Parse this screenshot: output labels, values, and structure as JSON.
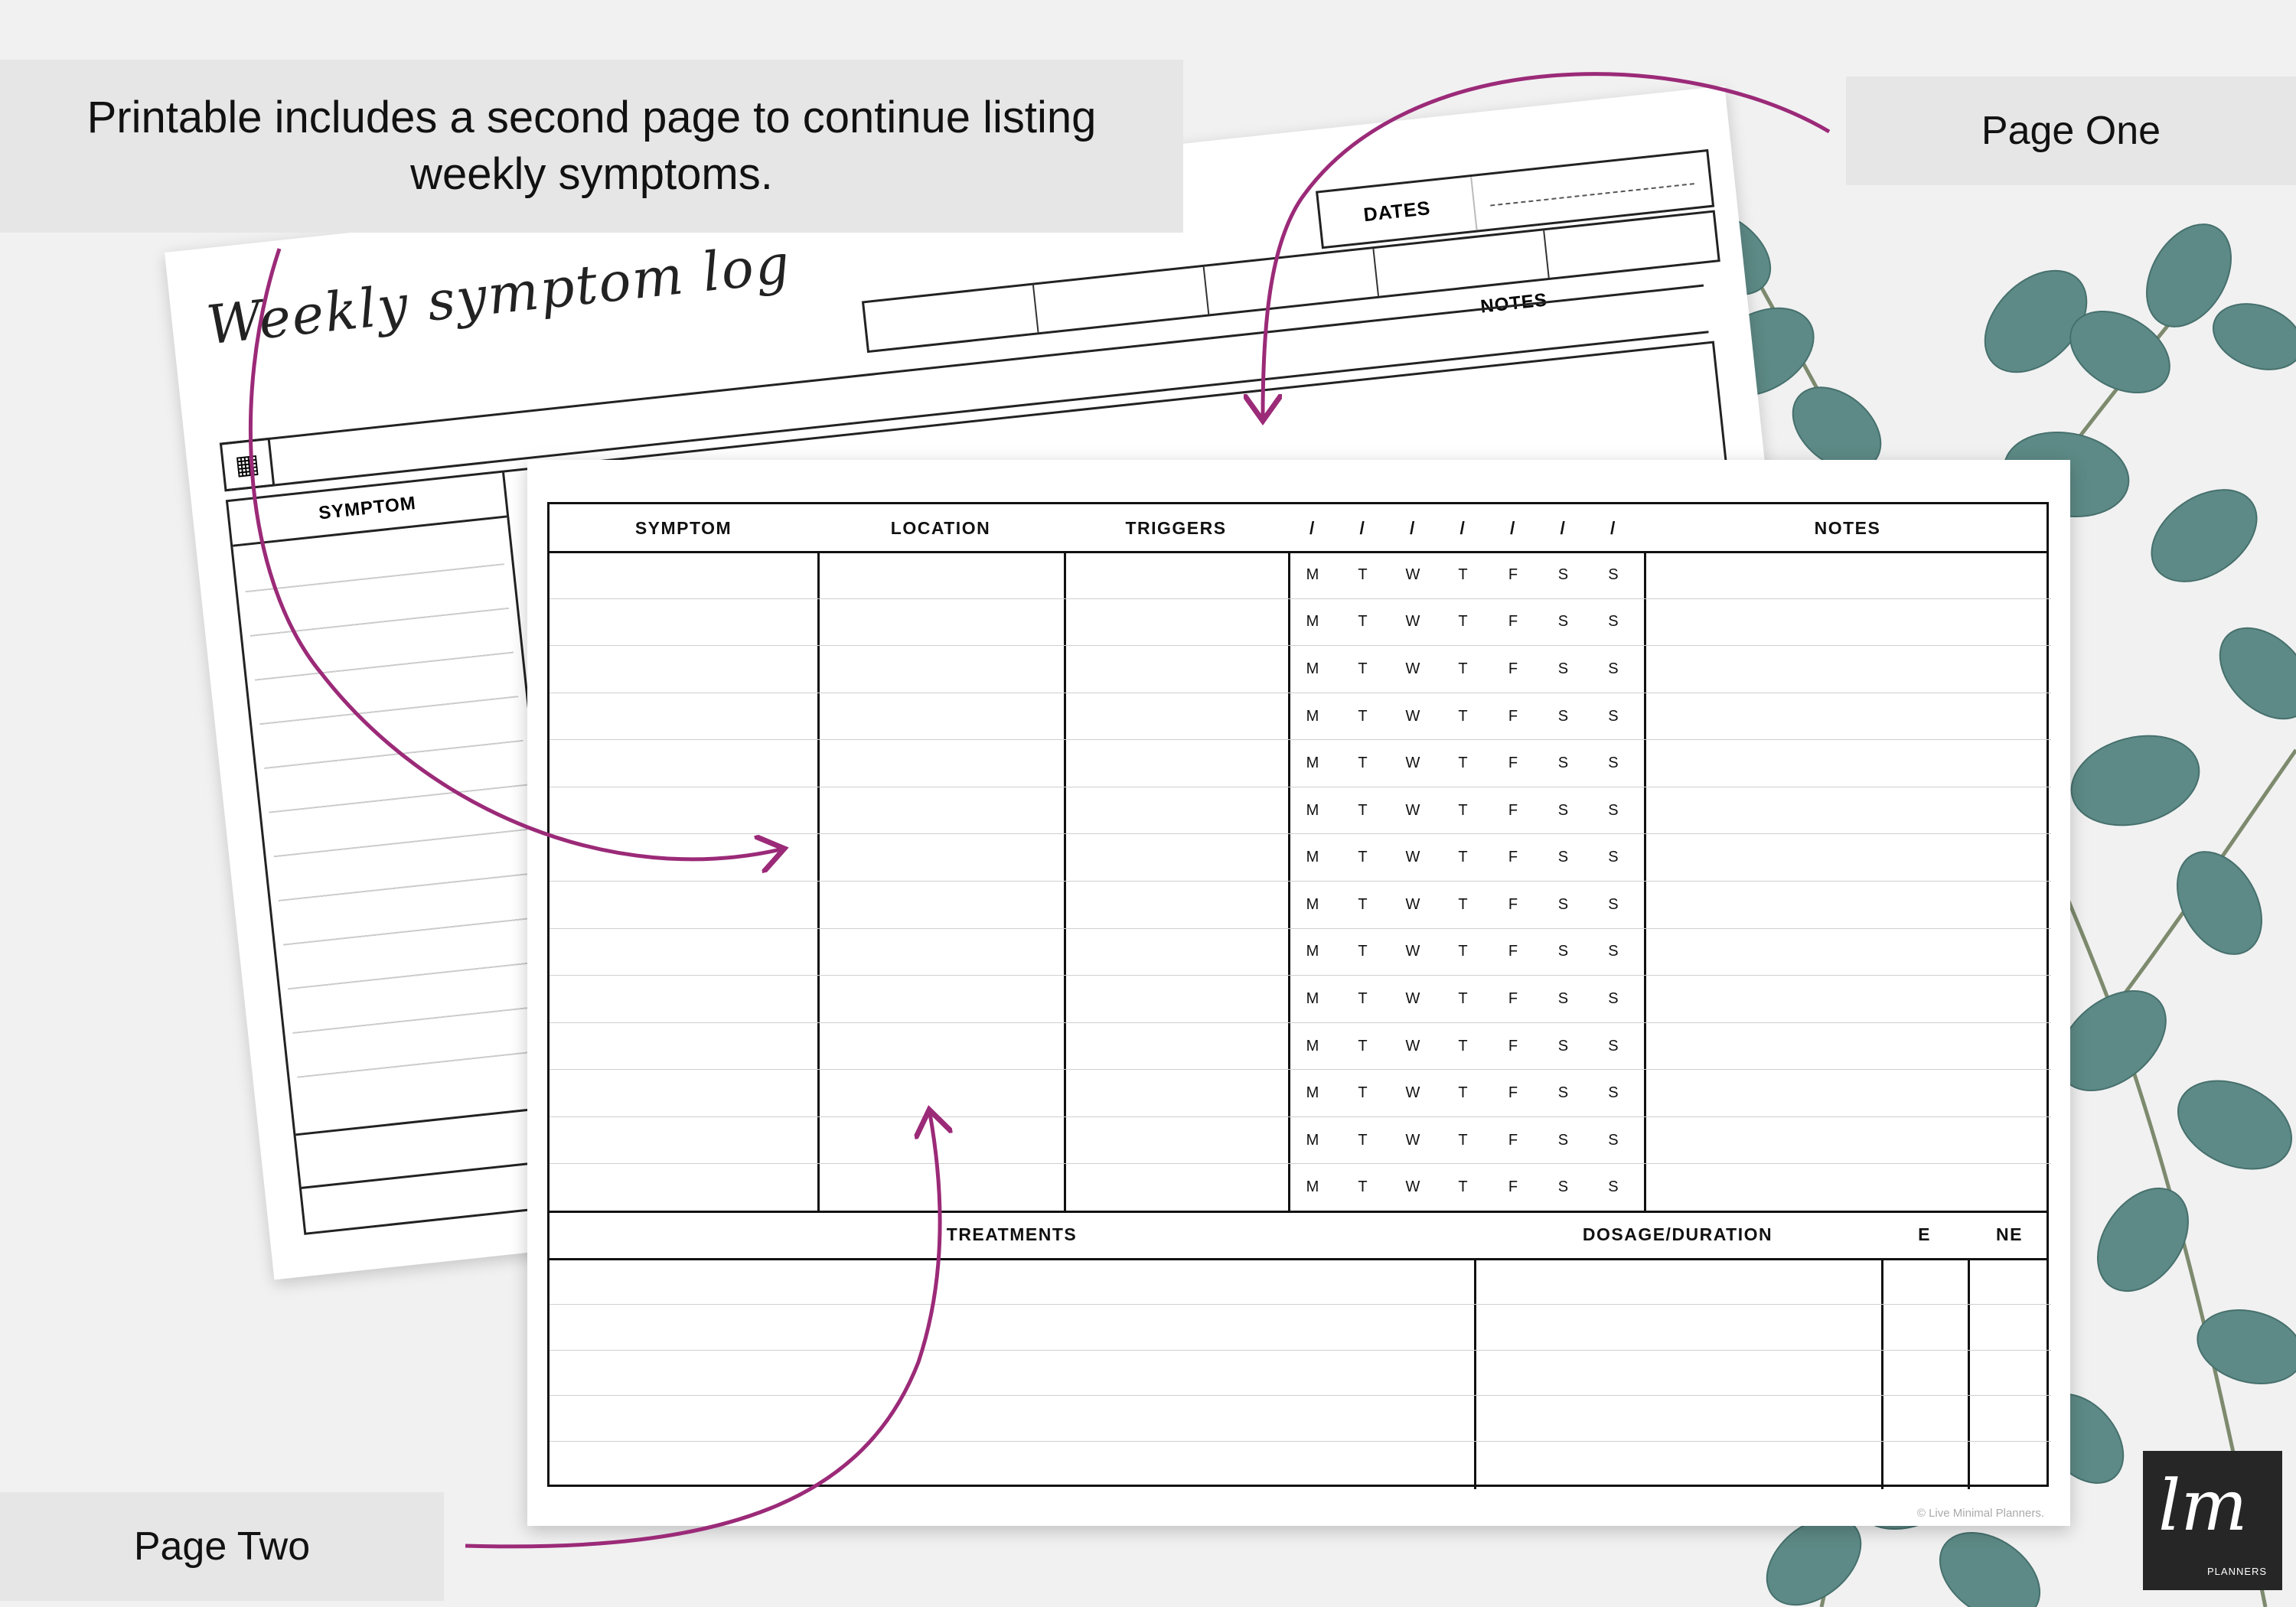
{
  "callouts": {
    "main_line1": "Printable includes a second page to continue listing",
    "main_line2": "weekly symptoms.",
    "page_one": "Page One",
    "page_two": "Page Two"
  },
  "page_one": {
    "title": "Weekly symptom log",
    "dates_label": "DATES",
    "notes_label": "NOTES",
    "symptom_label": "SYMPTOM",
    "icon": "grid-icon"
  },
  "page_two": {
    "headers": {
      "symptom": "SYMPTOM",
      "location": "LOCATION",
      "triggers": "TRIGGERS",
      "date_slashes": [
        "/",
        "/",
        "/",
        "/",
        "/",
        "/",
        "/"
      ],
      "notes": "NOTES"
    },
    "days": [
      "M",
      "T",
      "W",
      "T",
      "F",
      "S",
      "S"
    ],
    "symptom_rows": 14,
    "treatment_headers": {
      "treatments": "TREATMENTS",
      "dosage": "DOSAGE/DURATION",
      "e": "E",
      "ne": "NE"
    },
    "copyright": "© Live Minimal Planners."
  },
  "logo": {
    "mark": "lm",
    "word": "PLANNERS"
  },
  "colors": {
    "arrow": "#9b2a78",
    "callout_bg": "#e6e6e6",
    "leaf": "#5d8a86",
    "logo_bg": "#262626"
  }
}
